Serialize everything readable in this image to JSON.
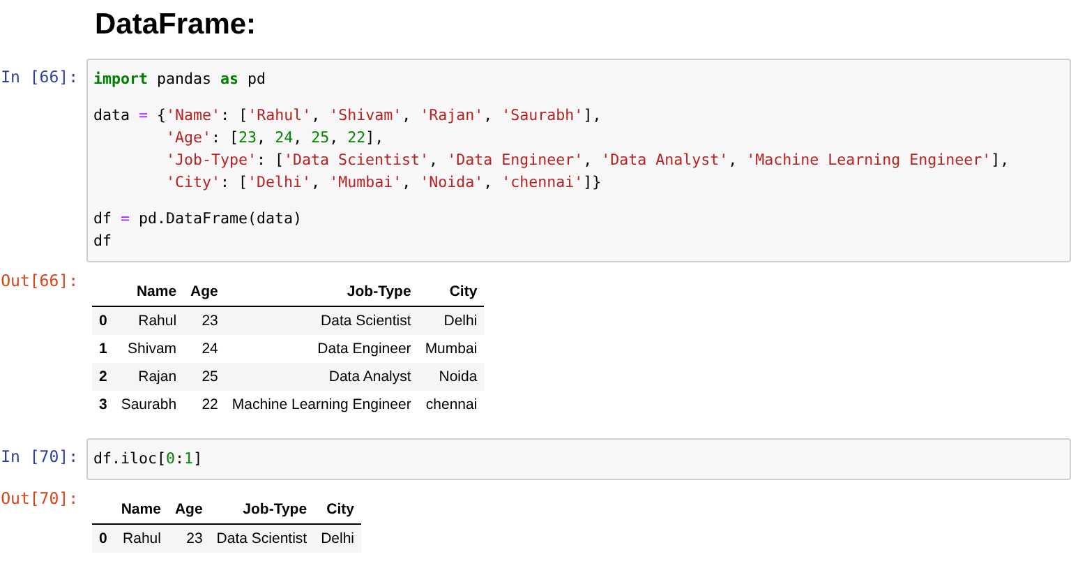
{
  "heading": "DataFrame:",
  "cells": [
    {
      "in_prompt": "In [66]:",
      "code": [
        {
          "tokens": [
            {
              "kind": "keyword",
              "text": "import"
            },
            {
              "kind": "plain",
              "text": " pandas "
            },
            {
              "kind": "keyword",
              "text": "as"
            },
            {
              "kind": "plain",
              "text": " pd"
            }
          ]
        },
        {
          "blank_before": true,
          "tokens": [
            {
              "kind": "plain",
              "text": "data "
            },
            {
              "kind": "operator",
              "text": "="
            },
            {
              "kind": "plain",
              "text": " {"
            },
            {
              "kind": "string",
              "text": "'Name'"
            },
            {
              "kind": "plain",
              "text": ": ["
            },
            {
              "kind": "string",
              "text": "'Rahul'"
            },
            {
              "kind": "plain",
              "text": ", "
            },
            {
              "kind": "string",
              "text": "'Shivam'"
            },
            {
              "kind": "plain",
              "text": ", "
            },
            {
              "kind": "string",
              "text": "'Rajan'"
            },
            {
              "kind": "plain",
              "text": ", "
            },
            {
              "kind": "string",
              "text": "'Saurabh'"
            },
            {
              "kind": "plain",
              "text": "],"
            }
          ]
        },
        {
          "indented": true,
          "tokens": [
            {
              "kind": "string",
              "text": "'Age'"
            },
            {
              "kind": "plain",
              "text": ": ["
            },
            {
              "kind": "number",
              "text": "23"
            },
            {
              "kind": "plain",
              "text": ", "
            },
            {
              "kind": "number",
              "text": "24"
            },
            {
              "kind": "plain",
              "text": ", "
            },
            {
              "kind": "number",
              "text": "25"
            },
            {
              "kind": "plain",
              "text": ", "
            },
            {
              "kind": "number",
              "text": "22"
            },
            {
              "kind": "plain",
              "text": "],"
            }
          ]
        },
        {
          "indented": true,
          "tokens": [
            {
              "kind": "string",
              "text": "'Job-Type'"
            },
            {
              "kind": "plain",
              "text": ": ["
            },
            {
              "kind": "string",
              "text": "'Data Scientist'"
            },
            {
              "kind": "plain",
              "text": ", "
            },
            {
              "kind": "string",
              "text": "'Data Engineer'"
            },
            {
              "kind": "plain",
              "text": ", "
            },
            {
              "kind": "string",
              "text": "'Data Analyst'"
            },
            {
              "kind": "plain",
              "text": ", "
            },
            {
              "kind": "string",
              "text": "'Machine Learning Engineer'"
            },
            {
              "kind": "plain",
              "text": "],"
            }
          ]
        },
        {
          "indented": true,
          "tokens": [
            {
              "kind": "string",
              "text": "'City'"
            },
            {
              "kind": "plain",
              "text": ": ["
            },
            {
              "kind": "string",
              "text": "'Delhi'"
            },
            {
              "kind": "plain",
              "text": ", "
            },
            {
              "kind": "string",
              "text": "'Mumbai'"
            },
            {
              "kind": "plain",
              "text": ", "
            },
            {
              "kind": "string",
              "text": "'Noida'"
            },
            {
              "kind": "plain",
              "text": ", "
            },
            {
              "kind": "string",
              "text": "'chennai'"
            },
            {
              "kind": "plain",
              "text": "]}"
            }
          ]
        },
        {
          "blank_before": true,
          "tokens": [
            {
              "kind": "plain",
              "text": "df "
            },
            {
              "kind": "operator",
              "text": "="
            },
            {
              "kind": "plain",
              "text": " pd.DataFrame(data)"
            }
          ]
        },
        {
          "tokens": [
            {
              "kind": "plain",
              "text": "df"
            }
          ]
        }
      ],
      "out_prompt": "Out[66]:",
      "table": {
        "columns": [
          "Name",
          "Age",
          "Job-Type",
          "City"
        ],
        "rows": [
          {
            "index": "0",
            "cells": [
              "Rahul",
              "23",
              "Data Scientist",
              "Delhi"
            ]
          },
          {
            "index": "1",
            "cells": [
              "Shivam",
              "24",
              "Data Engineer",
              "Mumbai"
            ]
          },
          {
            "index": "2",
            "cells": [
              "Rajan",
              "25",
              "Data Analyst",
              "Noida"
            ]
          },
          {
            "index": "3",
            "cells": [
              "Saurabh",
              "22",
              "Machine Learning Engineer",
              "chennai"
            ]
          }
        ]
      }
    },
    {
      "in_prompt": "In [70]:",
      "code": [
        {
          "tokens": [
            {
              "kind": "plain",
              "text": "df.iloc["
            },
            {
              "kind": "number",
              "text": "0"
            },
            {
              "kind": "plain",
              "text": ":"
            },
            {
              "kind": "number",
              "text": "1"
            },
            {
              "kind": "plain",
              "text": "]"
            }
          ]
        }
      ],
      "out_prompt": "Out[70]:",
      "table": {
        "columns": [
          "Name",
          "Age",
          "Job-Type",
          "City"
        ],
        "rows": [
          {
            "index": "0",
            "cells": [
              "Rahul",
              "23",
              "Data Scientist",
              "Delhi"
            ]
          }
        ]
      }
    }
  ]
}
